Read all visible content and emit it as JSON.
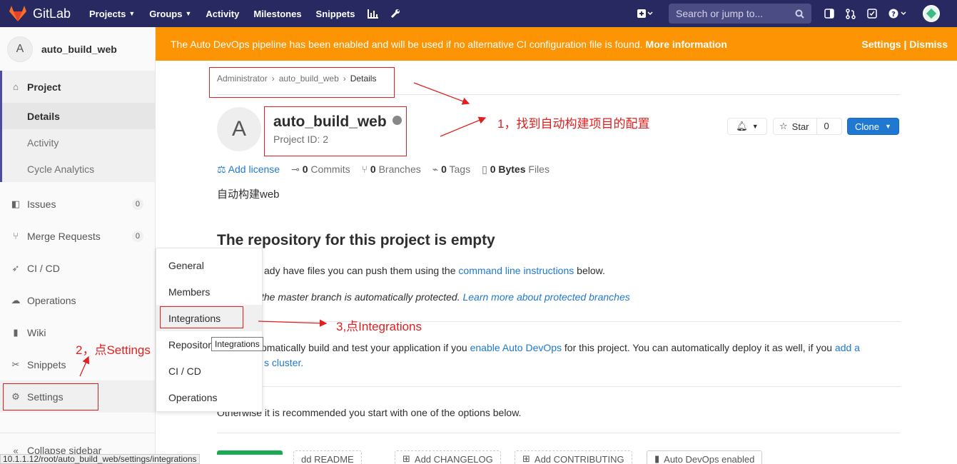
{
  "navbar": {
    "brand": "GitLab",
    "links": [
      {
        "label": "Projects",
        "dropdown": true
      },
      {
        "label": "Groups",
        "dropdown": true
      },
      {
        "label": "Activity",
        "dropdown": false
      },
      {
        "label": "Milestones",
        "dropdown": false
      },
      {
        "label": "Snippets",
        "dropdown": false
      }
    ],
    "search_placeholder": "Search or jump to...",
    "colors": {
      "navbar": "#292961",
      "banner": "#fc9403",
      "primary": "#1f78d1",
      "annotation": "#e02020"
    }
  },
  "sidebar": {
    "avatar_letter": "A",
    "project_name": "auto_build_web",
    "project_label": "Project",
    "project_sub": [
      "Details",
      "Activity",
      "Cycle Analytics"
    ],
    "issues": {
      "label": "Issues",
      "count": "0"
    },
    "merge_requests": {
      "label": "Merge Requests",
      "count": "0"
    },
    "cicd": "CI / CD",
    "operations": "Operations",
    "wiki": "Wiki",
    "snippets": "Snippets",
    "settings": "Settings",
    "collapse": "Collapse sidebar"
  },
  "flyout": {
    "items": [
      "General",
      "Members",
      "Integrations",
      "Repository",
      "CI / CD",
      "Operations"
    ],
    "tooltip": "Integrations"
  },
  "banner": {
    "text": "The Auto DevOps pipeline has been enabled and will be used if no alternative CI configuration file is found.",
    "more": "More information",
    "settings": "Settings",
    "sep": "|",
    "dismiss": "Dismiss"
  },
  "breadcrumb": [
    "Administrator",
    "auto_build_web",
    "Details"
  ],
  "project": {
    "avatar_letter": "A",
    "name": "auto_build_web",
    "id_text": "Project ID: 2",
    "star_label": "Star",
    "star_count": "0",
    "clone_label": "Clone",
    "description": "自动构建web"
  },
  "stats": {
    "add_license": "Add license",
    "commits_count": "0",
    "commits_label": "Commits",
    "branches_count": "0",
    "branches_label": "Branches",
    "tags_count": "0",
    "tags_label": "Tags",
    "files_size": "0 Bytes",
    "files_label": "Files"
  },
  "empty": {
    "title": "The repository for this project is empty",
    "p1_pre": "ady have files you can push them using the",
    "p1_link": "command line instructions",
    "p1_post": "below.",
    "p2_pre": "the master branch is automatically protected.",
    "p2_link": "Learn more about protected branches",
    "p3_pre": "omatically build and test your application if you",
    "p3_link": "enable Auto DevOps",
    "p3_mid": "for this project. You can automatically deploy it as well, if you",
    "p3_link2": "add a",
    "p3_line2": "s cluster.",
    "p4": "Otherwise it is recommended you start with one of the options below."
  },
  "options": [
    "dd README",
    "Add CHANGELOG",
    "Add CONTRIBUTING",
    "Auto DevOps enabled"
  ],
  "annotations": {
    "a1": "1，找到自动构建项目的配置",
    "a2": "2，点Settings",
    "a3": "3,点Integrations"
  },
  "status_url": "10.1.1.12/root/auto_build_web/settings/integrations"
}
